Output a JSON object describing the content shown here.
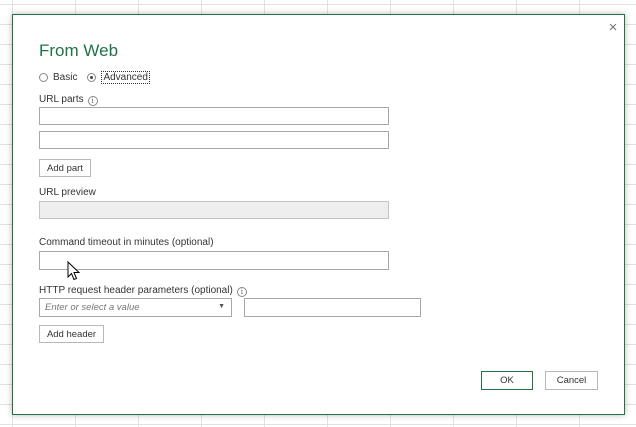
{
  "dialog": {
    "title": "From Web",
    "close_label": "×",
    "mode": {
      "basic_label": "Basic",
      "advanced_label": "Advanced",
      "selected": "Advanced"
    },
    "url_parts_label": "URL parts",
    "url_parts_values": [
      "",
      ""
    ],
    "add_part_label": "Add part",
    "url_preview_label": "URL preview",
    "url_preview_value": "",
    "timeout_label": "Command timeout in minutes (optional)",
    "timeout_value": "",
    "http_header_label": "HTTP request header parameters (optional)",
    "header_key_placeholder": "Enter or select a value",
    "header_value": "",
    "add_header_label": "Add header",
    "ok_label": "OK",
    "cancel_label": "Cancel",
    "accent_color": "#217346"
  }
}
